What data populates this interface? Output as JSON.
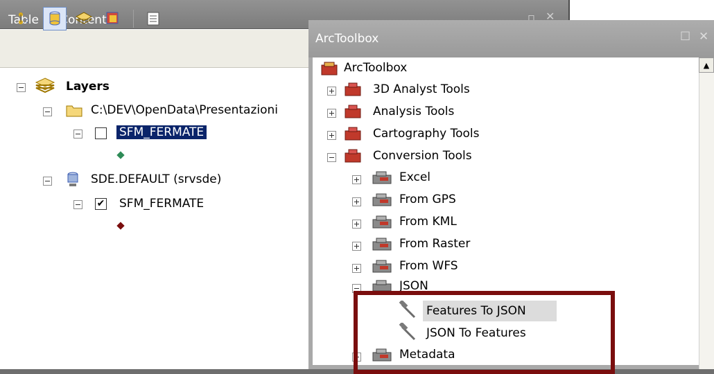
{
  "toc": {
    "title": "Table Of Contents",
    "tree": {
      "layers_label": "Layers",
      "folder_label": "C:\\DEV\\OpenData\\Presentazioni",
      "folder_layer": "SFM_FERMATE",
      "sde_label": "SDE.DEFAULT (srvsde)",
      "sde_layer": "SFM_FERMATE"
    },
    "colors": {
      "folder_point": "#2e8b57",
      "sde_point": "#7a0e0e",
      "selection": "#0a246a"
    }
  },
  "toolbox": {
    "title": "ArcToolbox",
    "root": "ArcToolbox",
    "toolsets": [
      "3D Analyst Tools",
      "Analysis Tools",
      "Cartography Tools",
      "Conversion Tools"
    ],
    "conversion_children": [
      "Excel",
      "From GPS",
      "From KML",
      "From Raster",
      "From WFS",
      "JSON"
    ],
    "json_tools": [
      "Features To JSON",
      "JSON To Features"
    ],
    "after": "Metadata"
  },
  "annotation": {
    "box_color": "#7a0e0e"
  }
}
